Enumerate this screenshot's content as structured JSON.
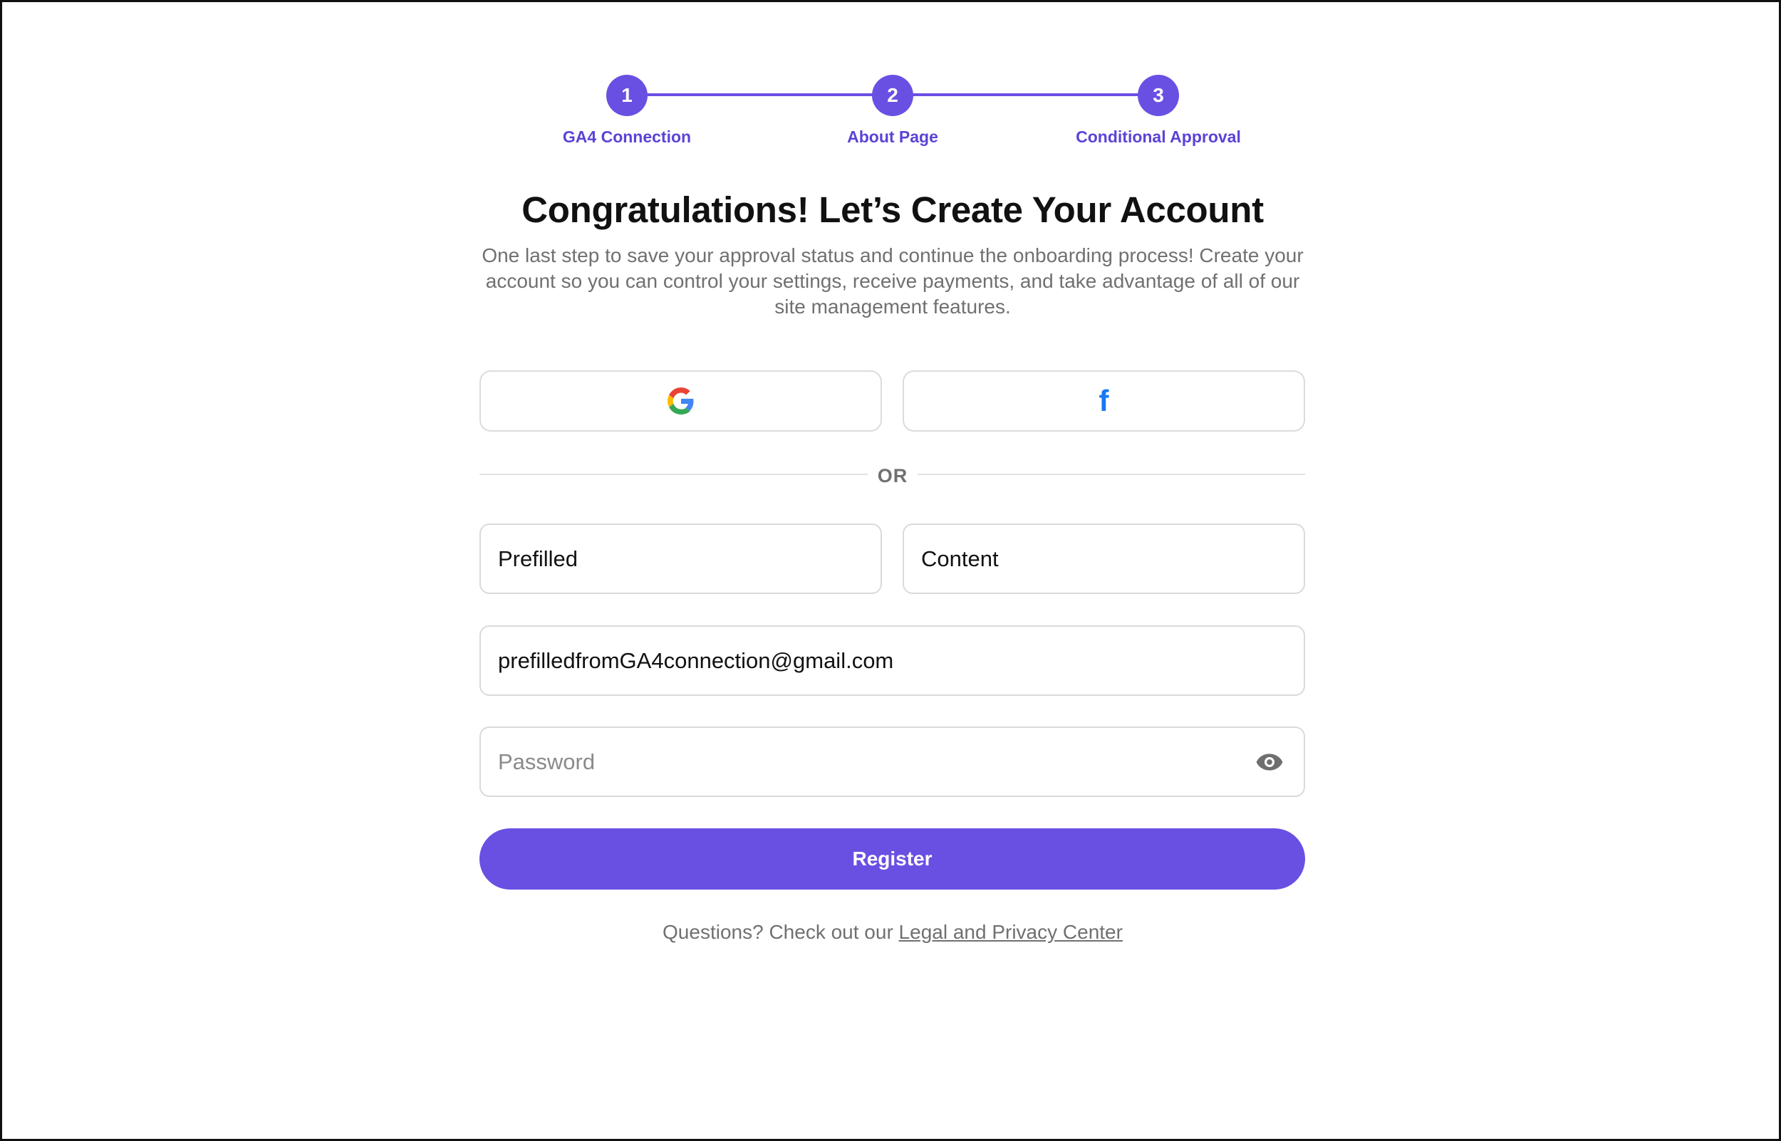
{
  "stepper": {
    "steps": [
      {
        "number": "1",
        "label": "GA4 Connection"
      },
      {
        "number": "2",
        "label": "About Page"
      },
      {
        "number": "3",
        "label": "Conditional Approval"
      }
    ],
    "accent_color": "#6a4fe3"
  },
  "heading": {
    "title": "Congratulations! Let’s Create Your Account",
    "subtitle": "One last step to save your approval status and continue the onboarding process! Create your account so you can control your settings, receive payments, and take advantage of all of our site management features."
  },
  "social": {
    "google_icon": "google-g-icon",
    "facebook_icon": "facebook-f-icon",
    "facebook_glyph": "f"
  },
  "divider": {
    "text": "OR"
  },
  "form": {
    "first_name_value": "Prefilled",
    "last_name_value": "Content",
    "email_value": "prefilledfromGA4connection@gmail.com",
    "password_placeholder": "Password",
    "password_toggle_icon": "eye-icon",
    "register_label": "Register"
  },
  "footer": {
    "text": "Questions? Check out our ",
    "link": "Legal and Privacy Center"
  }
}
